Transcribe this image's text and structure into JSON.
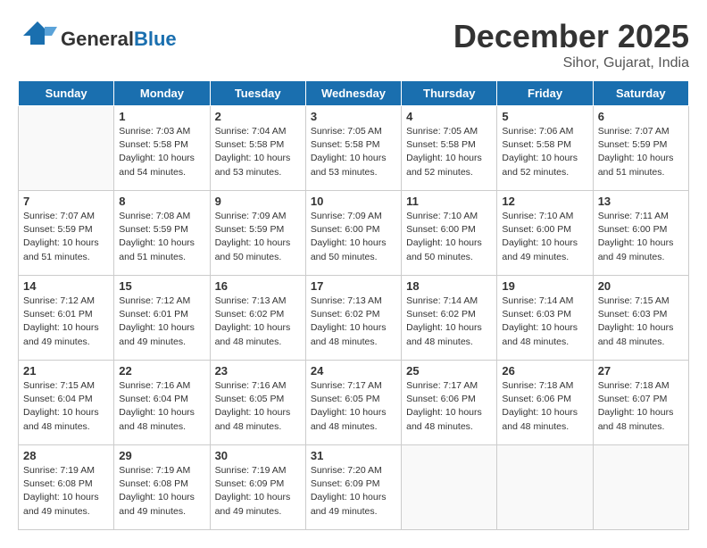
{
  "header": {
    "logo_general": "General",
    "logo_blue": "Blue",
    "month": "December 2025",
    "location": "Sihor, Gujarat, India"
  },
  "days_of_week": [
    "Sunday",
    "Monday",
    "Tuesday",
    "Wednesday",
    "Thursday",
    "Friday",
    "Saturday"
  ],
  "weeks": [
    [
      {
        "day": "",
        "sunrise": "",
        "sunset": "",
        "daylight": "",
        "empty": true
      },
      {
        "day": "1",
        "sunrise": "Sunrise: 7:03 AM",
        "sunset": "Sunset: 5:58 PM",
        "daylight": "Daylight: 10 hours and 54 minutes."
      },
      {
        "day": "2",
        "sunrise": "Sunrise: 7:04 AM",
        "sunset": "Sunset: 5:58 PM",
        "daylight": "Daylight: 10 hours and 53 minutes."
      },
      {
        "day": "3",
        "sunrise": "Sunrise: 7:05 AM",
        "sunset": "Sunset: 5:58 PM",
        "daylight": "Daylight: 10 hours and 53 minutes."
      },
      {
        "day": "4",
        "sunrise": "Sunrise: 7:05 AM",
        "sunset": "Sunset: 5:58 PM",
        "daylight": "Daylight: 10 hours and 52 minutes."
      },
      {
        "day": "5",
        "sunrise": "Sunrise: 7:06 AM",
        "sunset": "Sunset: 5:58 PM",
        "daylight": "Daylight: 10 hours and 52 minutes."
      },
      {
        "day": "6",
        "sunrise": "Sunrise: 7:07 AM",
        "sunset": "Sunset: 5:59 PM",
        "daylight": "Daylight: 10 hours and 51 minutes."
      }
    ],
    [
      {
        "day": "7",
        "sunrise": "Sunrise: 7:07 AM",
        "sunset": "Sunset: 5:59 PM",
        "daylight": "Daylight: 10 hours and 51 minutes."
      },
      {
        "day": "8",
        "sunrise": "Sunrise: 7:08 AM",
        "sunset": "Sunset: 5:59 PM",
        "daylight": "Daylight: 10 hours and 51 minutes."
      },
      {
        "day": "9",
        "sunrise": "Sunrise: 7:09 AM",
        "sunset": "Sunset: 5:59 PM",
        "daylight": "Daylight: 10 hours and 50 minutes."
      },
      {
        "day": "10",
        "sunrise": "Sunrise: 7:09 AM",
        "sunset": "Sunset: 6:00 PM",
        "daylight": "Daylight: 10 hours and 50 minutes."
      },
      {
        "day": "11",
        "sunrise": "Sunrise: 7:10 AM",
        "sunset": "Sunset: 6:00 PM",
        "daylight": "Daylight: 10 hours and 50 minutes."
      },
      {
        "day": "12",
        "sunrise": "Sunrise: 7:10 AM",
        "sunset": "Sunset: 6:00 PM",
        "daylight": "Daylight: 10 hours and 49 minutes."
      },
      {
        "day": "13",
        "sunrise": "Sunrise: 7:11 AM",
        "sunset": "Sunset: 6:00 PM",
        "daylight": "Daylight: 10 hours and 49 minutes."
      }
    ],
    [
      {
        "day": "14",
        "sunrise": "Sunrise: 7:12 AM",
        "sunset": "Sunset: 6:01 PM",
        "daylight": "Daylight: 10 hours and 49 minutes."
      },
      {
        "day": "15",
        "sunrise": "Sunrise: 7:12 AM",
        "sunset": "Sunset: 6:01 PM",
        "daylight": "Daylight: 10 hours and 49 minutes."
      },
      {
        "day": "16",
        "sunrise": "Sunrise: 7:13 AM",
        "sunset": "Sunset: 6:02 PM",
        "daylight": "Daylight: 10 hours and 48 minutes."
      },
      {
        "day": "17",
        "sunrise": "Sunrise: 7:13 AM",
        "sunset": "Sunset: 6:02 PM",
        "daylight": "Daylight: 10 hours and 48 minutes."
      },
      {
        "day": "18",
        "sunrise": "Sunrise: 7:14 AM",
        "sunset": "Sunset: 6:02 PM",
        "daylight": "Daylight: 10 hours and 48 minutes."
      },
      {
        "day": "19",
        "sunrise": "Sunrise: 7:14 AM",
        "sunset": "Sunset: 6:03 PM",
        "daylight": "Daylight: 10 hours and 48 minutes."
      },
      {
        "day": "20",
        "sunrise": "Sunrise: 7:15 AM",
        "sunset": "Sunset: 6:03 PM",
        "daylight": "Daylight: 10 hours and 48 minutes."
      }
    ],
    [
      {
        "day": "21",
        "sunrise": "Sunrise: 7:15 AM",
        "sunset": "Sunset: 6:04 PM",
        "daylight": "Daylight: 10 hours and 48 minutes."
      },
      {
        "day": "22",
        "sunrise": "Sunrise: 7:16 AM",
        "sunset": "Sunset: 6:04 PM",
        "daylight": "Daylight: 10 hours and 48 minutes."
      },
      {
        "day": "23",
        "sunrise": "Sunrise: 7:16 AM",
        "sunset": "Sunset: 6:05 PM",
        "daylight": "Daylight: 10 hours and 48 minutes."
      },
      {
        "day": "24",
        "sunrise": "Sunrise: 7:17 AM",
        "sunset": "Sunset: 6:05 PM",
        "daylight": "Daylight: 10 hours and 48 minutes."
      },
      {
        "day": "25",
        "sunrise": "Sunrise: 7:17 AM",
        "sunset": "Sunset: 6:06 PM",
        "daylight": "Daylight: 10 hours and 48 minutes."
      },
      {
        "day": "26",
        "sunrise": "Sunrise: 7:18 AM",
        "sunset": "Sunset: 6:06 PM",
        "daylight": "Daylight: 10 hours and 48 minutes."
      },
      {
        "day": "27",
        "sunrise": "Sunrise: 7:18 AM",
        "sunset": "Sunset: 6:07 PM",
        "daylight": "Daylight: 10 hours and 48 minutes."
      }
    ],
    [
      {
        "day": "28",
        "sunrise": "Sunrise: 7:19 AM",
        "sunset": "Sunset: 6:08 PM",
        "daylight": "Daylight: 10 hours and 49 minutes."
      },
      {
        "day": "29",
        "sunrise": "Sunrise: 7:19 AM",
        "sunset": "Sunset: 6:08 PM",
        "daylight": "Daylight: 10 hours and 49 minutes."
      },
      {
        "day": "30",
        "sunrise": "Sunrise: 7:19 AM",
        "sunset": "Sunset: 6:09 PM",
        "daylight": "Daylight: 10 hours and 49 minutes."
      },
      {
        "day": "31",
        "sunrise": "Sunrise: 7:20 AM",
        "sunset": "Sunset: 6:09 PM",
        "daylight": "Daylight: 10 hours and 49 minutes."
      },
      {
        "day": "",
        "sunrise": "",
        "sunset": "",
        "daylight": "",
        "empty": true
      },
      {
        "day": "",
        "sunrise": "",
        "sunset": "",
        "daylight": "",
        "empty": true
      },
      {
        "day": "",
        "sunrise": "",
        "sunset": "",
        "daylight": "",
        "empty": true
      }
    ]
  ]
}
